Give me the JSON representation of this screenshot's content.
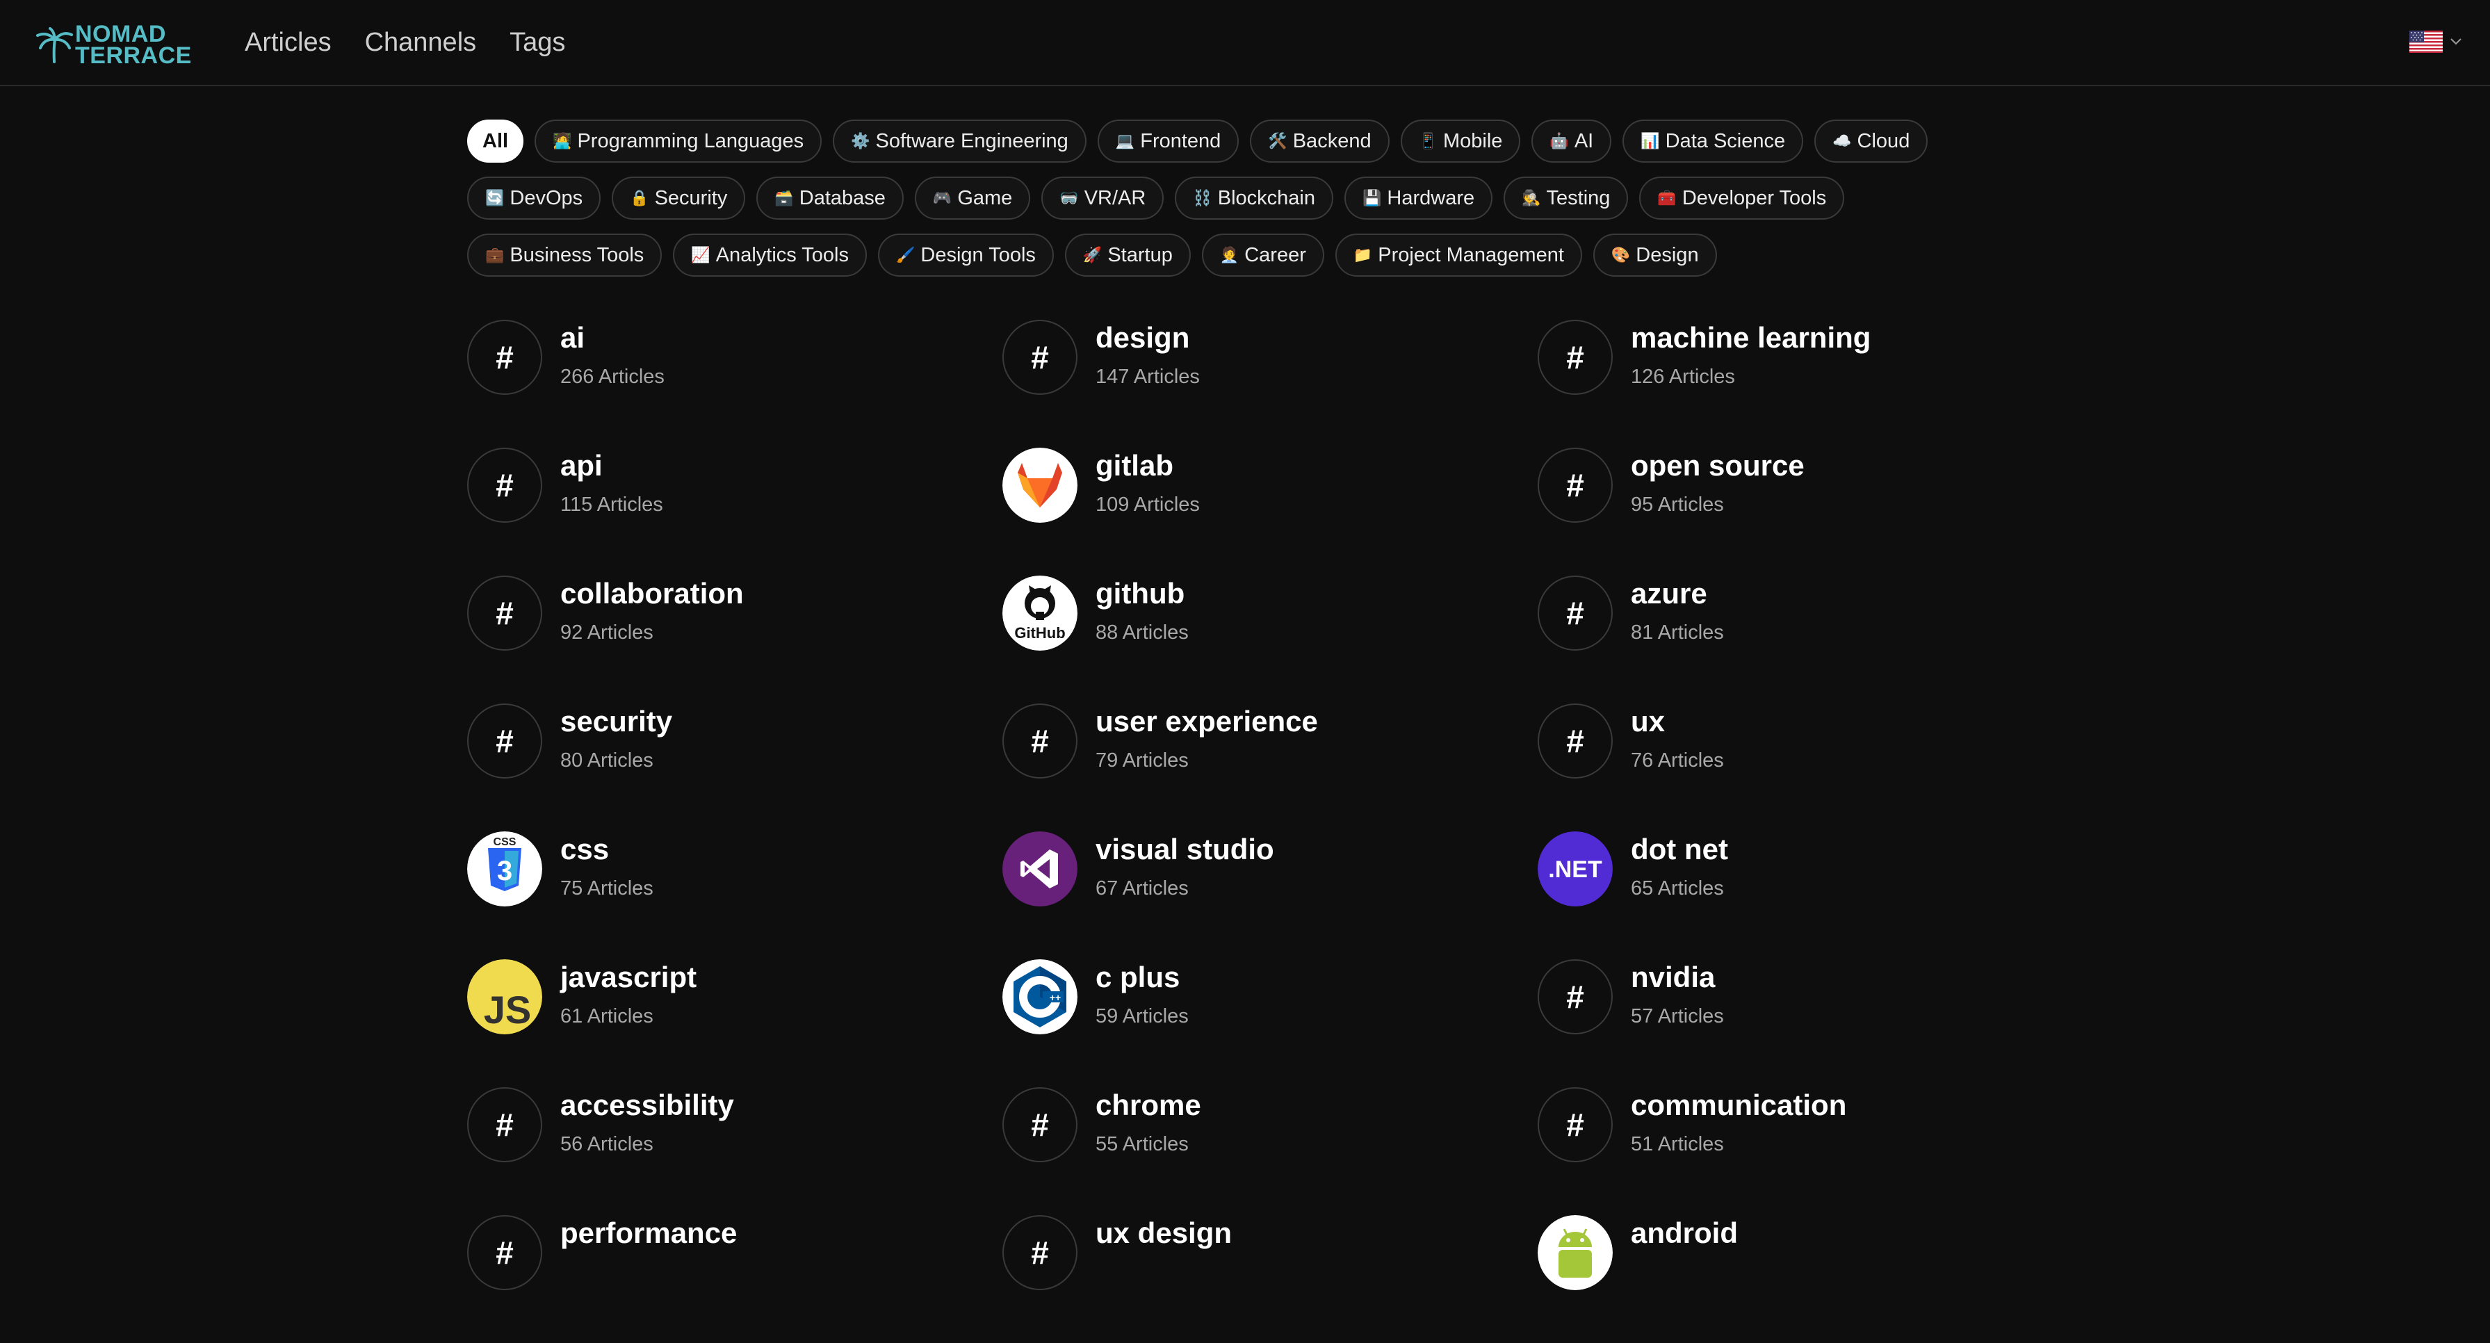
{
  "brand": {
    "line1": "NOMAD",
    "line2": "TERRACE",
    "color": "#56bcc6"
  },
  "nav": [
    {
      "id": "articles",
      "label": "Articles"
    },
    {
      "id": "channels",
      "label": "Channels"
    },
    {
      "id": "tags",
      "label": "Tags"
    }
  ],
  "language": {
    "flag_icon": "us-flag-icon"
  },
  "categories": [
    {
      "emoji": "",
      "label": "All",
      "active": true
    },
    {
      "emoji": "🧑‍💻",
      "label": "Programming Languages"
    },
    {
      "emoji": "⚙️",
      "label": "Software Engineering"
    },
    {
      "emoji": "💻",
      "label": "Frontend"
    },
    {
      "emoji": "🛠️",
      "label": "Backend"
    },
    {
      "emoji": "📱",
      "label": "Mobile"
    },
    {
      "emoji": "🤖",
      "label": "AI"
    },
    {
      "emoji": "📊",
      "label": "Data Science"
    },
    {
      "emoji": "☁️",
      "label": "Cloud"
    },
    {
      "emoji": "🔄",
      "label": "DevOps"
    },
    {
      "emoji": "🔒",
      "label": "Security"
    },
    {
      "emoji": "🗃️",
      "label": "Database"
    },
    {
      "emoji": "🎮",
      "label": "Game"
    },
    {
      "emoji": "🥽",
      "label": "VR/AR"
    },
    {
      "emoji": "⛓️",
      "label": "Blockchain"
    },
    {
      "emoji": "💾",
      "label": "Hardware"
    },
    {
      "emoji": "🕵️",
      "label": "Testing"
    },
    {
      "emoji": "🧰",
      "label": "Developer Tools"
    },
    {
      "emoji": "💼",
      "label": "Business Tools"
    },
    {
      "emoji": "📈",
      "label": "Analytics Tools"
    },
    {
      "emoji": "🖌️",
      "label": "Design Tools"
    },
    {
      "emoji": "🚀",
      "label": "Startup"
    },
    {
      "emoji": "🧑‍💼",
      "label": "Career"
    },
    {
      "emoji": "📁",
      "label": "Project Management"
    },
    {
      "emoji": "🎨",
      "label": "Design"
    }
  ],
  "tags": [
    {
      "name": "ai",
      "count": "266 Articles",
      "icon": "hash"
    },
    {
      "name": "design",
      "count": "147 Articles",
      "icon": "hash"
    },
    {
      "name": "machine learning",
      "count": "126 Articles",
      "icon": "hash"
    },
    {
      "name": "api",
      "count": "115 Articles",
      "icon": "hash"
    },
    {
      "name": "gitlab",
      "count": "109 Articles",
      "icon": "gitlab"
    },
    {
      "name": "open source",
      "count": "95 Articles",
      "icon": "hash"
    },
    {
      "name": "collaboration",
      "count": "92 Articles",
      "icon": "hash"
    },
    {
      "name": "github",
      "count": "88 Articles",
      "icon": "github"
    },
    {
      "name": "azure",
      "count": "81 Articles",
      "icon": "hash"
    },
    {
      "name": "security",
      "count": "80 Articles",
      "icon": "hash"
    },
    {
      "name": "user experience",
      "count": "79 Articles",
      "icon": "hash"
    },
    {
      "name": "ux",
      "count": "76 Articles",
      "icon": "hash"
    },
    {
      "name": "css",
      "count": "75 Articles",
      "icon": "css"
    },
    {
      "name": "visual studio",
      "count": "67 Articles",
      "icon": "visualstudio"
    },
    {
      "name": "dot net",
      "count": "65 Articles",
      "icon": "dotnet"
    },
    {
      "name": "javascript",
      "count": "61 Articles",
      "icon": "javascript"
    },
    {
      "name": "c plus",
      "count": "59 Articles",
      "icon": "cplus"
    },
    {
      "name": "nvidia",
      "count": "57 Articles",
      "icon": "hash"
    },
    {
      "name": "accessibility",
      "count": "56 Articles",
      "icon": "hash"
    },
    {
      "name": "chrome",
      "count": "55 Articles",
      "icon": "hash"
    },
    {
      "name": "communication",
      "count": "51 Articles",
      "icon": "hash"
    },
    {
      "name": "performance",
      "count": "",
      "icon": "hash"
    },
    {
      "name": "ux design",
      "count": "",
      "icon": "hash"
    },
    {
      "name": "android",
      "count": "",
      "icon": "android"
    }
  ],
  "icon_text": {
    "hash": "#",
    "github": "GitHub",
    "dotnet": ".NET",
    "javascript": "JS",
    "css": "CSS"
  },
  "colors": {
    "background": "#0e0e0e",
    "gitlab_orange": "#e24329",
    "visualstudio_purple": "#68217a",
    "dotnet_purple": "#512bd4",
    "javascript_yellow": "#f0db4f",
    "css_blue": "#2965f1",
    "cplus_blue": "#00599c",
    "android_green": "#a4c639"
  }
}
